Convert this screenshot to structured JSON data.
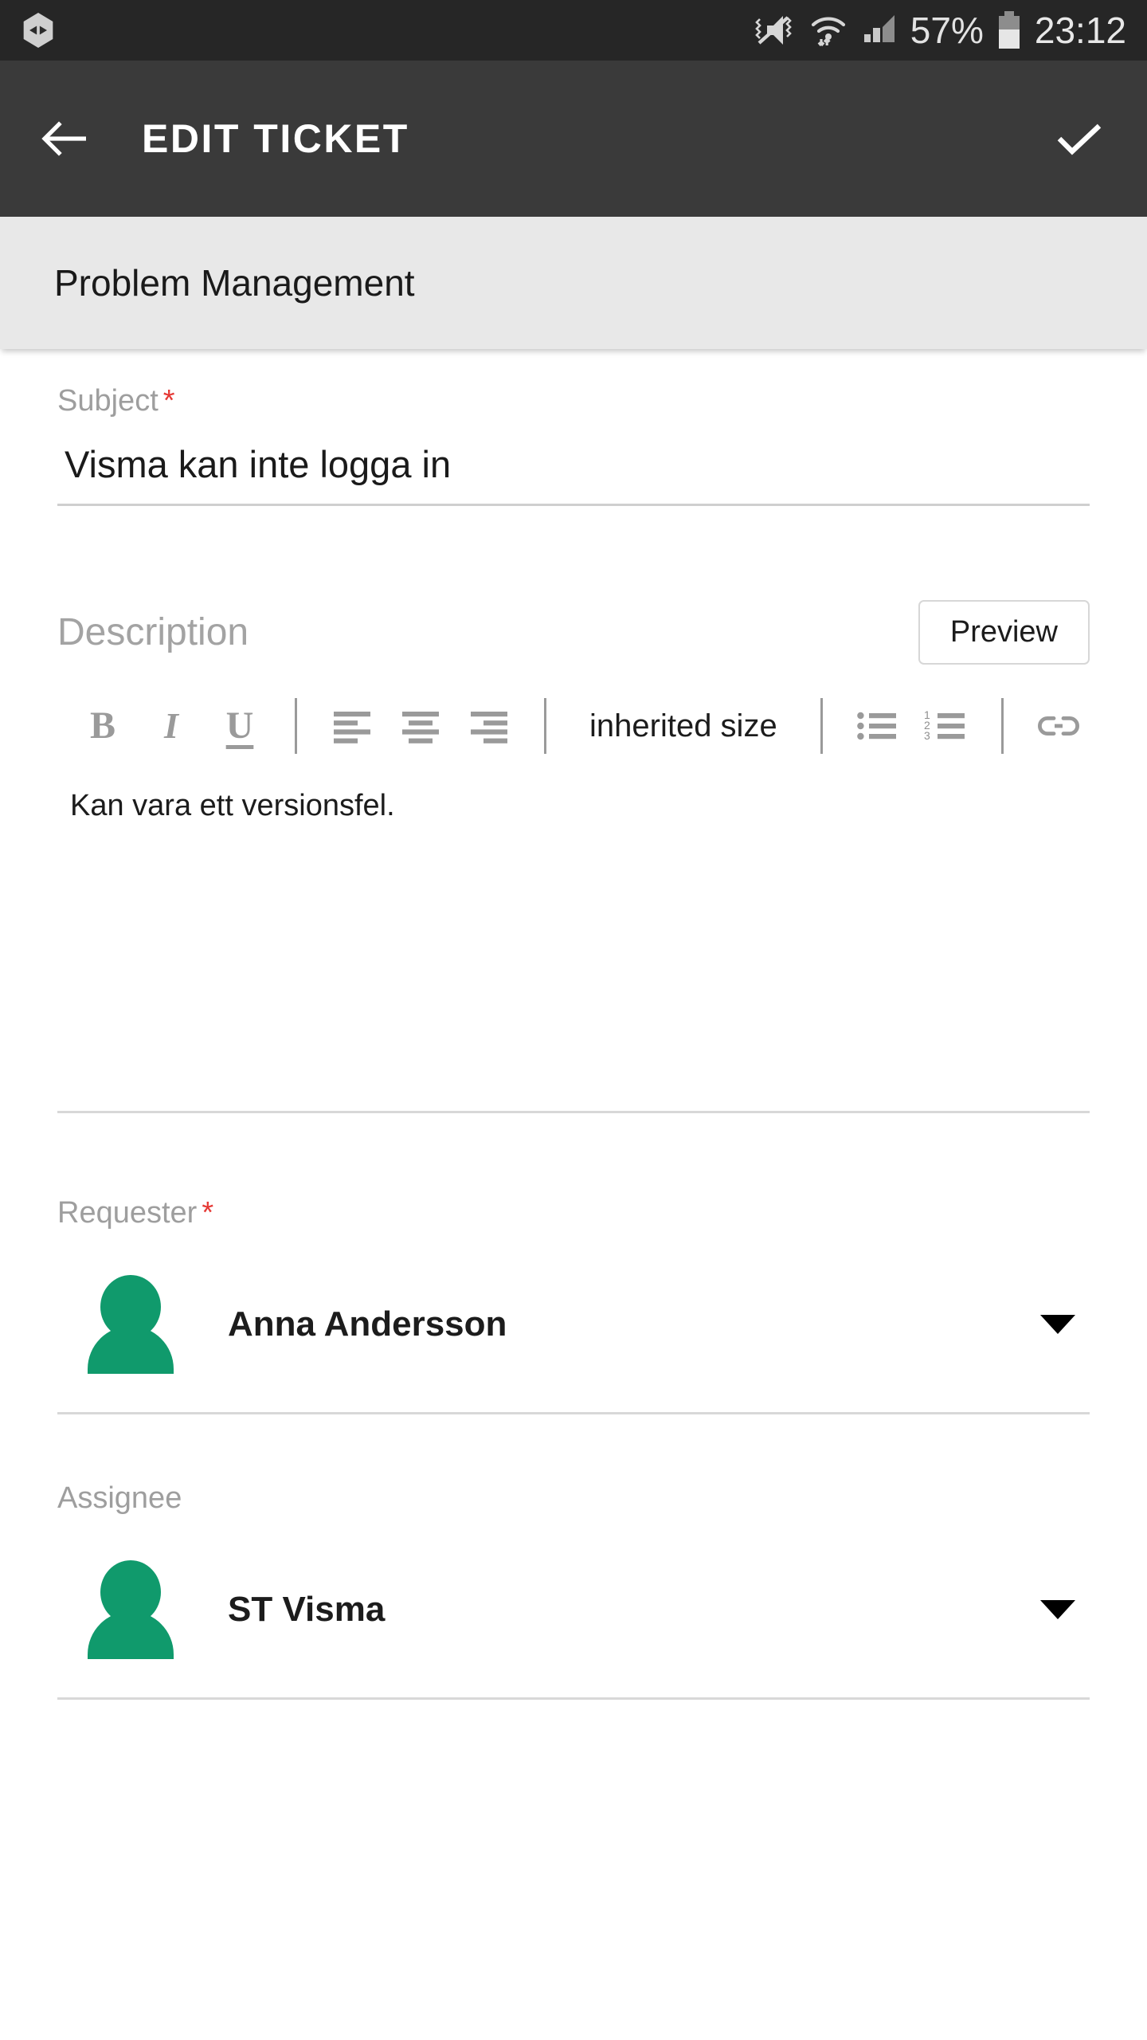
{
  "statusbar": {
    "icons": [
      "mute-vibrate-icon",
      "wifi-icon",
      "cell-signal-icon",
      "battery-icon"
    ],
    "notification_icon": "app-notification-icon",
    "battery_percent": "57%",
    "clock": "23:12"
  },
  "appbar": {
    "back_icon": "back-arrow-icon",
    "title": "EDIT TICKET",
    "confirm_icon": "checkmark-icon"
  },
  "category": {
    "label": "Problem Management"
  },
  "subject": {
    "label": "Subject",
    "required_mark": "*",
    "value": "Visma kan inte logga in"
  },
  "description": {
    "label": "Description",
    "preview_label": "Preview",
    "toolbar": {
      "bold": "B",
      "italic": "I",
      "underline": "U",
      "align_left": "align-left-icon",
      "align_center": "align-center-icon",
      "align_right": "align-right-icon",
      "size_label": "inherited size",
      "bullet_list": "bulleted-list-icon",
      "numbered_list": "numbered-list-icon",
      "link": "link-icon"
    },
    "body": "Kan vara ett versionsfel."
  },
  "requester": {
    "label": "Requester",
    "required_mark": "*",
    "name": "Anna Andersson",
    "avatar_color": "#109A6C",
    "caret": "chevron-down-icon"
  },
  "assignee": {
    "label": "Assignee",
    "name": "ST Visma",
    "avatar_color": "#109A6C",
    "caret": "chevron-down-icon"
  },
  "colors": {
    "appbar_bg": "#3a3a3a",
    "statusbar_bg": "#262626",
    "category_bg": "#e8e8e8",
    "accent_green": "#109A6C",
    "required_red": "#e53935",
    "label_gray": "#9e9e9e"
  }
}
